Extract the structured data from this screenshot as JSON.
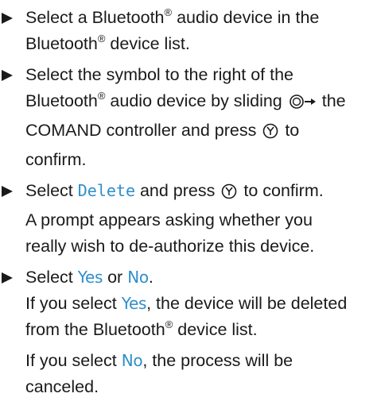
{
  "steps": [
    {
      "lines": [
        {
          "a": "Select a Bluetooth",
          "sup": "®",
          "b": " audio device in the"
        },
        {
          "a": "Bluetooth",
          "sup": "®",
          "b": " device list."
        }
      ]
    },
    {
      "l1": "Select the symbol to the right of the",
      "l2a": "Bluetooth",
      "l2sup": "®",
      "l2b": " audio device by sliding",
      "l2c": " the",
      "l3a": "COMAND controller and press",
      "l3b": " to",
      "l4": "confirm."
    },
    {
      "l1a": "Select ",
      "l1kw": "Delete",
      "l1b": " and press",
      "l1c": " to confirm.",
      "l2": "A prompt appears asking whether you",
      "l3": "really wish to de-authorize this device."
    },
    {
      "l1a": "Select ",
      "l1kw1": "Yes",
      "l1or": " or ",
      "l1kw2": "No",
      "l1end": ".",
      "l2a": "If you select ",
      "l2kw": "Yes",
      "l2b": ", the device will be deleted",
      "l3a": "from the Bluetooth",
      "l3sup": "®",
      "l3b": " device list.",
      "p2a": "If you select ",
      "p2kw": "No",
      "p2b": ", the process will be",
      "p2c": "canceled."
    }
  ],
  "icons": {
    "bullet": "triangle-bullet-icon",
    "slide": "controller-slide-right-icon",
    "press": "controller-press-icon"
  }
}
